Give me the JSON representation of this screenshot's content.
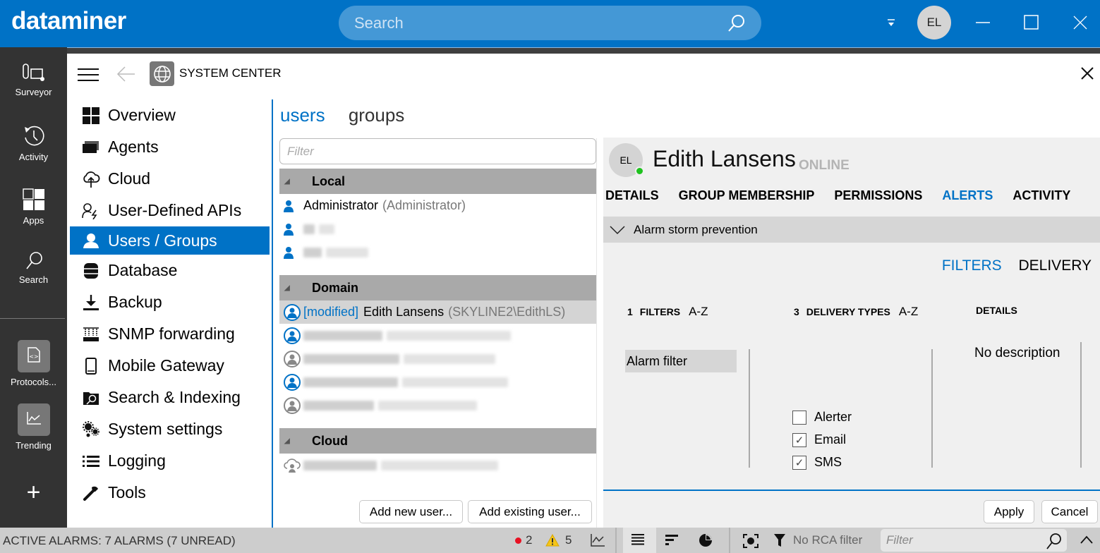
{
  "app": {
    "logo": "dataminer",
    "search_placeholder": "Search",
    "user_initials": "EL"
  },
  "rail": {
    "items": [
      {
        "label": "Surveyor",
        "icon": "surveyor-icon"
      },
      {
        "label": "Activity",
        "icon": "history-icon"
      },
      {
        "label": "Apps",
        "icon": "apps-grid-icon"
      },
      {
        "label": "Search",
        "icon": "search-icon"
      }
    ],
    "apps": [
      {
        "label": "Protocols...",
        "icon": "protocol-file-icon"
      },
      {
        "label": "Trending",
        "icon": "trend-chart-icon"
      }
    ],
    "add_label": "+"
  },
  "header": {
    "title": "SYSTEM CENTER"
  },
  "nav": {
    "items": [
      {
        "label": "Overview",
        "icon": "overview-grid-icon",
        "active": false
      },
      {
        "label": "Agents",
        "icon": "agents-icon",
        "active": false
      },
      {
        "label": "Cloud",
        "icon": "cloud-icon",
        "active": false
      },
      {
        "label": "User-Defined APIs",
        "icon": "user-api-icon",
        "active": false
      },
      {
        "label": "Users / Groups",
        "icon": "user-icon",
        "active": true
      },
      {
        "label": "Database",
        "icon": "database-icon",
        "active": false
      },
      {
        "label": "Backup",
        "icon": "download-icon",
        "active": false
      },
      {
        "label": "SNMP forwarding",
        "icon": "snmp-icon",
        "active": false
      },
      {
        "label": "Mobile Gateway",
        "icon": "mobile-icon",
        "active": false
      },
      {
        "label": "Search & Indexing",
        "icon": "folder-search-icon",
        "active": false
      },
      {
        "label": "System settings",
        "icon": "gears-icon",
        "active": false
      },
      {
        "label": "Logging",
        "icon": "list-icon",
        "active": false
      },
      {
        "label": "Tools",
        "icon": "wrench-icon",
        "active": false
      }
    ]
  },
  "users_panel": {
    "tabs": [
      {
        "label": "users",
        "active": true
      },
      {
        "label": "groups",
        "active": false
      }
    ],
    "filter_placeholder": "Filter",
    "groups": [
      {
        "name": "Local",
        "users": [
          {
            "name": "Administrator",
            "account": "(Administrator)",
            "redacted": false
          },
          {
            "name": "[redacted]",
            "account": "[redacted]",
            "redacted": true
          },
          {
            "name": "[redacted]",
            "account": "[redacted]",
            "redacted": true
          }
        ]
      },
      {
        "name": "Domain",
        "users": [
          {
            "modified_tag": "[modified]",
            "name": "Edith Lansens",
            "account": "(SKYLINE2\\EdithLS)",
            "redacted": false,
            "selected": true
          },
          {
            "name": "[redacted]",
            "account": "[redacted]",
            "redacted": true
          },
          {
            "name": "[redacted]",
            "account": "[redacted]",
            "redacted": true
          },
          {
            "name": "[redacted]",
            "account": "[redacted]",
            "redacted": true
          },
          {
            "name": "[redacted]",
            "account": "[redacted]",
            "redacted": true
          }
        ]
      },
      {
        "name": "Cloud",
        "users": [
          {
            "name": "[redacted]",
            "account": "[redacted]",
            "redacted": true
          }
        ]
      }
    ],
    "add_new_label": "Add new user...",
    "add_existing_label": "Add existing user..."
  },
  "detail": {
    "initials": "EL",
    "name": "Edith Lansens",
    "status": "ONLINE",
    "tabs": [
      {
        "label": "DETAILS",
        "active": false
      },
      {
        "label": "GROUP MEMBERSHIP",
        "active": false
      },
      {
        "label": "PERMISSIONS",
        "active": false
      },
      {
        "label": "ALERTS",
        "active": true
      },
      {
        "label": "ACTIVITY",
        "active": false
      }
    ],
    "section_title": "Alarm storm prevention",
    "sub_tabs": [
      {
        "label": "FILTERS",
        "active": true
      },
      {
        "label": "DELIVERY",
        "active": false
      }
    ],
    "filters_col": {
      "count": "1",
      "title": "FILTERS",
      "sort": "A-Z",
      "items": [
        "Alarm filter"
      ]
    },
    "delivery_col": {
      "count": "3",
      "title": "DELIVERY TYPES",
      "sort": "A-Z",
      "items": [
        {
          "label": "Alerter",
          "checked": false
        },
        {
          "label": "Email",
          "checked": true
        },
        {
          "label": "SMS",
          "checked": true
        }
      ]
    },
    "details_col": {
      "title": "DETAILS",
      "text": "No description"
    },
    "apply_label": "Apply",
    "cancel_label": "Cancel"
  },
  "statusbar": {
    "active_alarms": "ACTIVE ALARMS: 7 ALARMS (7 UNREAD)",
    "critical_count": "2",
    "warning_count": "5",
    "rca_filter": "No RCA filter",
    "filter_placeholder": "Filter",
    "colors": {
      "critical": "#e81123",
      "warning": "#f5c518",
      "accent": "#0072c6"
    }
  }
}
